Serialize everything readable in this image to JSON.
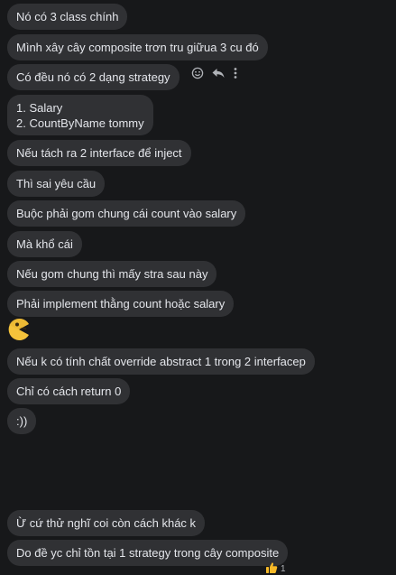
{
  "messages": [
    {
      "text": "Nó có 3 class chính"
    },
    {
      "text": "Mình xây cây composite trơn tru giữua 3 cu đó"
    },
    {
      "text": "Có đều nó có 2 dạng strategy"
    },
    {
      "lines": [
        "1. Salary",
        "2. CountByName tommy"
      ]
    },
    {
      "text": "Nếu tách ra 2 interface để inject"
    },
    {
      "text": "Thì sai yêu cầu"
    },
    {
      "text": "Buộc phải gom chung cái count vào salary"
    },
    {
      "text": "Mà khổ cái"
    },
    {
      "text": "Nếu gom chung thì mấy stra sau này"
    },
    {
      "text": "Phải implement thằng count hoặc salary"
    },
    {
      "sticker": "pacman-face-icon"
    },
    {
      "text": "Nếu k có tính chất override abstract 1 trong 2 interfacep"
    },
    {
      "text": "Chỉ có cách return 0"
    },
    {
      "text": ":))"
    },
    {
      "text": "Ừ cứ thử nghĩ coi còn cách khác k"
    },
    {
      "text": "Do đề yc chỉ tồn tại 1 strategy trong cây composite"
    }
  ],
  "hover_actions": [
    "smile-icon",
    "reply-icon",
    "more-icon"
  ],
  "reaction": {
    "emoji": "thumbs-up-icon",
    "count": "1"
  },
  "colors": {
    "background": "#17181a",
    "bubble": "#303134",
    "text": "#e4e6eb",
    "muted": "#b0b3b8",
    "thumbs": "#f7b928"
  }
}
